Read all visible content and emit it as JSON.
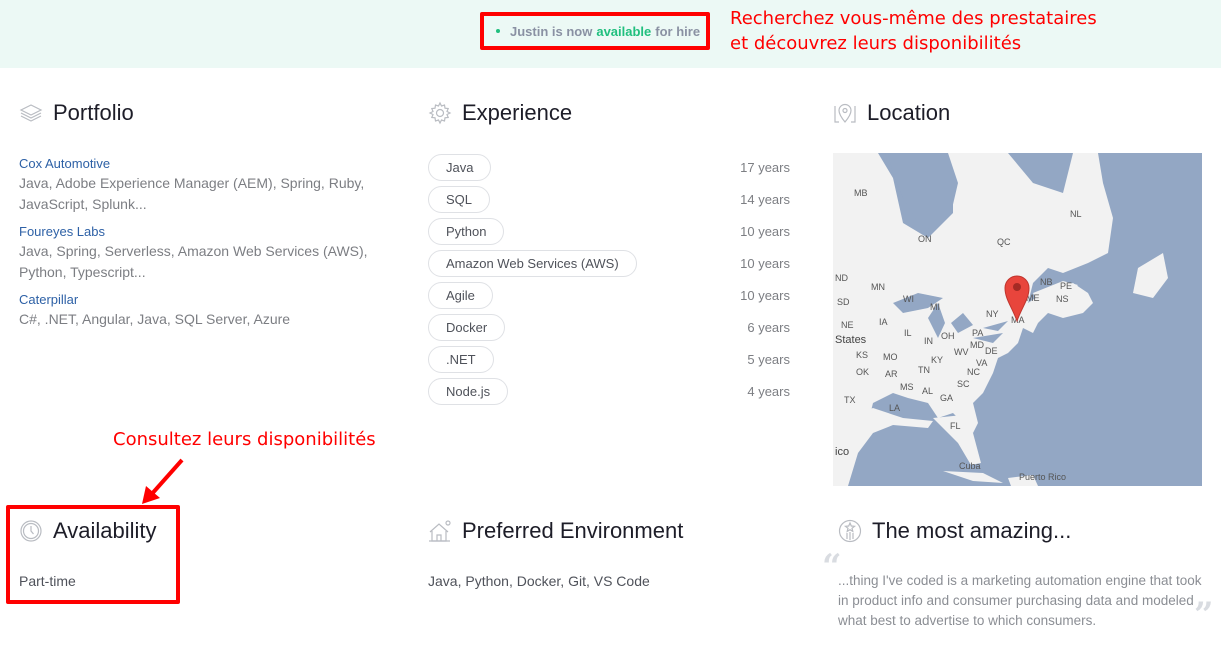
{
  "banner": {
    "prefix": "Justin is now",
    "highlight": "available",
    "suffix": "for hire",
    "accent_color": "#20bf7e"
  },
  "annotations": {
    "top_line1": "Recherchez vous-même des prestataires",
    "top_line2": "et découvrez leurs disponibilités",
    "availability_note": "Consultez leurs disponibilités",
    "color": "#ff0000"
  },
  "portfolio": {
    "title": "Portfolio",
    "icon": "layers-icon",
    "items": [
      {
        "name": "Cox Automotive",
        "skills": "Java, Adobe Experience Manager (AEM), Spring, Ruby, JavaScript, Splunk..."
      },
      {
        "name": "Foureyes Labs",
        "skills": "Java, Spring, Serverless, Amazon Web Services (AWS), Python, Typescript..."
      },
      {
        "name": "Caterpillar",
        "skills": "C#, .NET, Angular, Java, SQL Server, Azure"
      }
    ]
  },
  "experience": {
    "title": "Experience",
    "icon": "gear-icon",
    "items": [
      {
        "skill": "Java",
        "years": "17 years"
      },
      {
        "skill": "SQL",
        "years": "14 years"
      },
      {
        "skill": "Python",
        "years": "10 years"
      },
      {
        "skill": "Amazon Web Services (AWS)",
        "years": "10 years"
      },
      {
        "skill": "Agile",
        "years": "10 years"
      },
      {
        "skill": "Docker",
        "years": "6 years"
      },
      {
        "skill": ".NET",
        "years": "5 years"
      },
      {
        "skill": "Node.js",
        "years": "4 years"
      }
    ]
  },
  "location": {
    "title": "Location",
    "icon": "map-pin-icon",
    "map_labels": [
      "MB",
      "ON",
      "QC",
      "NL",
      "ND",
      "MN",
      "SD",
      "NE",
      "IA",
      "WI",
      "MI",
      "NY",
      "NB",
      "PE",
      "NS",
      "ME",
      "MA",
      "IL",
      "IN",
      "OH",
      "PA",
      "MD",
      "DE",
      "KS",
      "MO",
      "KY",
      "WV",
      "VA",
      "OK",
      "AR",
      "TN",
      "NC",
      "MS",
      "AL",
      "SC",
      "GA",
      "TX",
      "LA",
      "FL",
      "Cuba",
      "Puerto Rico",
      "States",
      "ico"
    ]
  },
  "availability": {
    "title": "Availability",
    "icon": "clock-icon",
    "value": "Part-time"
  },
  "environment": {
    "title": "Preferred Environment",
    "icon": "house-icon",
    "value": "Java, Python, Docker, Git, VS Code"
  },
  "amazing": {
    "title": "The most amazing...",
    "icon": "star-badge-icon",
    "quote": "...thing I've coded is a marketing automation engine that took in product info and consumer purchasing data and modeled what best to advertise to which consumers.",
    "open_quote": "“",
    "close_quote": "”"
  }
}
